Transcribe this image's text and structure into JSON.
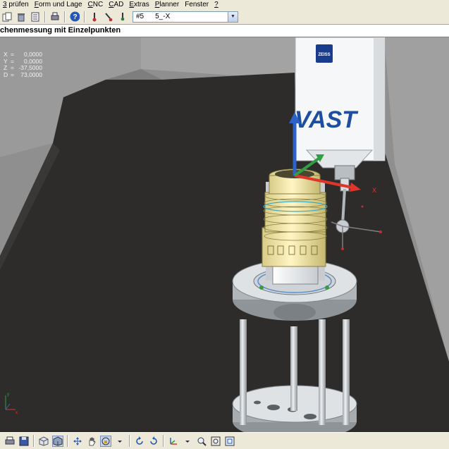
{
  "menubar": {
    "items": [
      {
        "accel": "3",
        "rest": " prüfen"
      },
      {
        "accel": "F",
        "rest": "orm und Lage"
      },
      {
        "accel": "C",
        "rest": "NC"
      },
      {
        "accel": "C",
        "rest": "AD"
      },
      {
        "accel": "E",
        "rest": "xtras"
      },
      {
        "accel": "P",
        "rest": "lanner"
      },
      {
        "accel": "",
        "rest": "Fenster"
      },
      {
        "accel": "?",
        "rest": ""
      }
    ]
  },
  "toolbar": {
    "combo_id": "#5",
    "combo_value": "5_-X"
  },
  "window": {
    "title": "chenmessung mit Einzelpunkten"
  },
  "readout": [
    {
      "axis": "X",
      "value": "0,0000"
    },
    {
      "axis": "Y",
      "value": "0,0000"
    },
    {
      "axis": "Z",
      "value": "-37,5000"
    },
    {
      "axis": "D",
      "value": "73,0000"
    }
  ],
  "scene": {
    "machine_brand": "ZEISS",
    "sensor_label": "VAST",
    "triad_label_x": "X",
    "corner_axis_x": "x",
    "corner_axis_y": "y",
    "colors": {
      "background": "#8f8f8f",
      "floor": "#2e2c2b",
      "part": "#f2e6a0",
      "x_axis": "#e0352a",
      "y_axis": "#2ea043",
      "z_axis": "#2d62c8"
    }
  },
  "bottom_toolbar": {
    "icons": [
      "print-icon",
      "floppy-icon",
      "view-cube-icon",
      "solid-cube-icon",
      "move-icon",
      "pan-hand-icon",
      "rotate-lock-icon",
      "rotate-left-icon",
      "rotate-right-icon",
      "axis-icon",
      "dropdown-icon",
      "zoom-icon",
      "zoom-extents-icon",
      "fit-view-icon"
    ]
  }
}
